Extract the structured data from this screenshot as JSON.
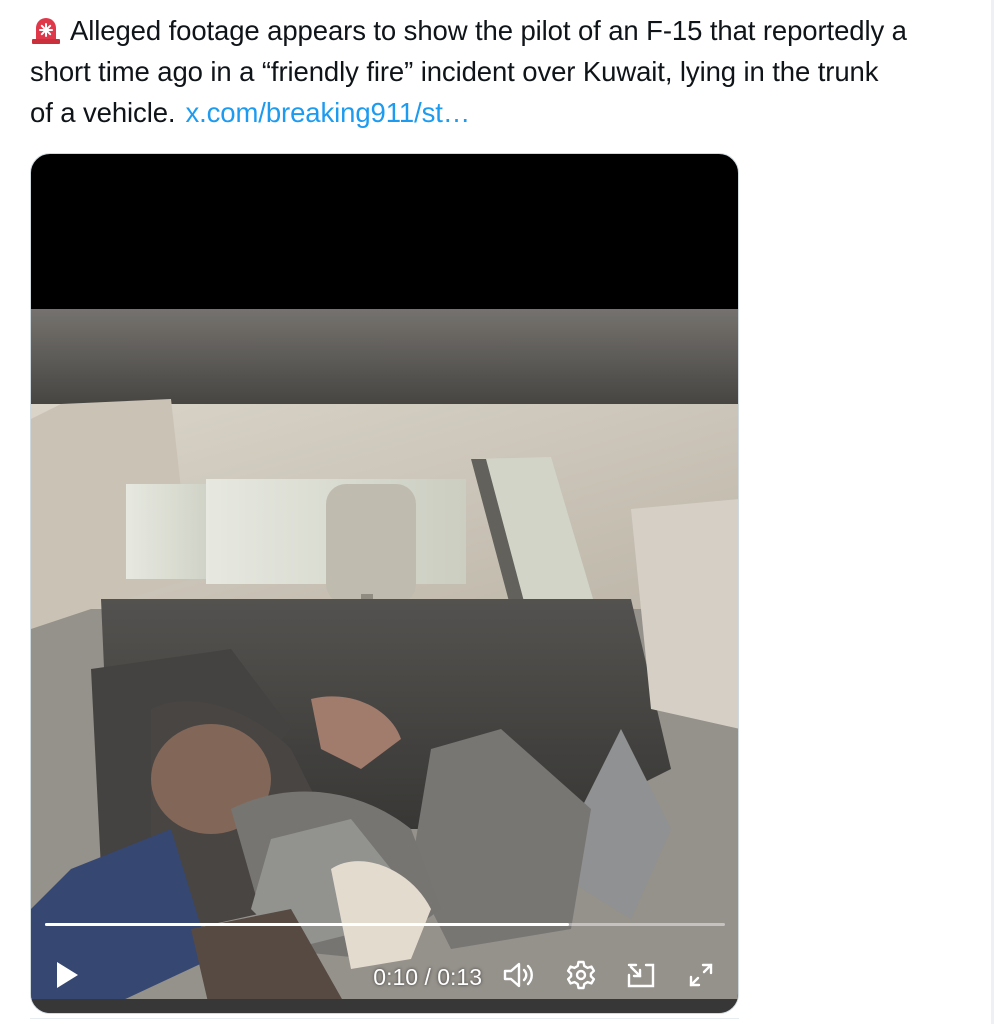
{
  "post": {
    "icon": "rotating-light-icon",
    "line1": "Alleged footage appears to show the pilot of an F-15 that reportedly a",
    "line2": "short time ago in a “friendly fire” incident over Kuwait, lying in the trunk",
    "line3": "of a vehicle.",
    "link": "x.com/breaking911/st…",
    "link_color": "#1d9bf0",
    "text_color": "#0f1419"
  },
  "video": {
    "current_time": "0:10",
    "separator": " / ",
    "duration": "0:13",
    "progress": 0.77,
    "controls": {
      "play": "play-icon",
      "mute": "volume-icon",
      "settings": "gear-icon",
      "pip": "picture-in-picture-icon",
      "fullscreen": "expand-icon"
    }
  }
}
